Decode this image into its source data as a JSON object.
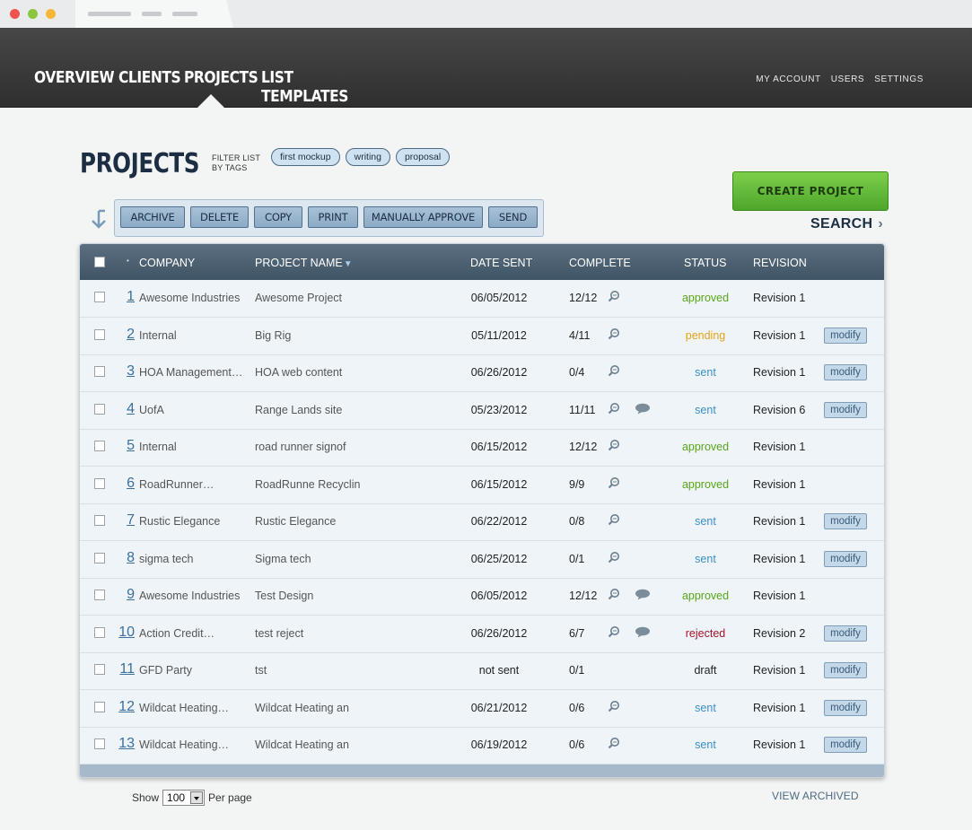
{
  "nav": {
    "main": [
      "OVERVIEW",
      "CLIENTS",
      "PROJECTS",
      "LIST TEMPLATES"
    ],
    "right": [
      "MY ACCOUNT",
      "USERS",
      "SETTINGS"
    ]
  },
  "page": {
    "title": "PROJECTS",
    "filter_label": "FILTER LIST BY TAGS",
    "tags": [
      "first mockup",
      "writing",
      "proposal"
    ],
    "create_button": "CREATE PROJECT",
    "search_label": "SEARCH",
    "search_chevron": "›"
  },
  "actions": [
    "ARCHIVE",
    "DELETE",
    "COPY",
    "PRINT",
    "MANUALLY APPROVE",
    "SEND"
  ],
  "table": {
    "headers": {
      "sort_marker": "•",
      "company": "COMPANY",
      "project": "PROJECT NAME",
      "date": "DATE SENT",
      "complete": "COMPLETE",
      "status": "STATUS",
      "revision": "REVISION"
    },
    "rows": [
      {
        "num": "1",
        "company": "Awesome Industries",
        "project": "Awesome Project",
        "date": "06/05/2012",
        "complete": "12/12",
        "zoom": true,
        "comment": false,
        "status": "approved",
        "revision": "Revision 1",
        "modify": ""
      },
      {
        "num": "2",
        "company": "Internal",
        "project": "Big Rig",
        "date": "05/11/2012",
        "complete": "4/11",
        "zoom": true,
        "comment": false,
        "status": "pending",
        "revision": "Revision 1",
        "modify": "modify"
      },
      {
        "num": "3",
        "company": "HOA Management…",
        "project": "HOA web content",
        "date": "06/26/2012",
        "complete": "0/4",
        "zoom": true,
        "comment": false,
        "status": "sent",
        "revision": "Revision 1",
        "modify": "modify"
      },
      {
        "num": "4",
        "company": "UofA",
        "project": "Range Lands site",
        "date": "05/23/2012",
        "complete": "11/11",
        "zoom": true,
        "comment": true,
        "status": "sent",
        "revision": "Revision 6",
        "modify": "modify"
      },
      {
        "num": "5",
        "company": "Internal",
        "project": "road runner signof",
        "date": "06/15/2012",
        "complete": "12/12",
        "zoom": true,
        "comment": false,
        "status": "approved",
        "revision": "Revision 1",
        "modify": ""
      },
      {
        "num": "6",
        "company": "RoadRunner…",
        "project": "RoadRunne Recyclin",
        "date": "06/15/2012",
        "complete": "9/9",
        "zoom": true,
        "comment": false,
        "status": "approved",
        "revision": "Revision 1",
        "modify": ""
      },
      {
        "num": "7",
        "company": "Rustic Elegance",
        "project": "Rustic Elegance",
        "date": "06/22/2012",
        "complete": "0/8",
        "zoom": true,
        "comment": false,
        "status": "sent",
        "revision": "Revision 1",
        "modify": "modify"
      },
      {
        "num": "8",
        "company": "sigma tech",
        "project": "Sigma tech",
        "date": "06/25/2012",
        "complete": "0/1",
        "zoom": true,
        "comment": false,
        "status": "sent",
        "revision": "Revision 1",
        "modify": "modify"
      },
      {
        "num": "9",
        "company": "Awesome Industries",
        "project": "Test Design",
        "date": "06/05/2012",
        "complete": "12/12",
        "zoom": true,
        "comment": true,
        "status": "approved",
        "revision": "Revision 1",
        "modify": ""
      },
      {
        "num": "10",
        "company": "Action Credit…",
        "project": "test reject",
        "date": "06/26/2012",
        "complete": "6/7",
        "zoom": true,
        "comment": true,
        "status": "rejected",
        "revision": "Revision 2",
        "modify": "modify"
      },
      {
        "num": "11",
        "company": "GFD Party",
        "project": "tst",
        "date": "not sent",
        "complete": "0/1",
        "zoom": false,
        "comment": false,
        "status": "draft",
        "revision": "Revision 1",
        "modify": "modify"
      },
      {
        "num": "12",
        "company": "Wildcat Heating…",
        "project": "Wildcat Heating an",
        "date": "06/21/2012",
        "complete": "0/6",
        "zoom": true,
        "comment": false,
        "status": "sent",
        "revision": "Revision 1",
        "modify": "modify"
      },
      {
        "num": "13",
        "company": "Wildcat Heating…",
        "project": "Wildcat Heating an",
        "date": "06/19/2012",
        "complete": "0/6",
        "zoom": true,
        "comment": false,
        "status": "sent",
        "revision": "Revision 1",
        "modify": "modify"
      }
    ]
  },
  "status_colors": {
    "approved": "#5aa61a",
    "pending": "#e3a514",
    "sent": "#3a8fc8",
    "rejected": "#a8142a",
    "draft": "#222222"
  },
  "footer": {
    "show_label": "Show",
    "per_page_value": "100",
    "per_page_label": "Per page",
    "view_archived": "VIEW ARCHIVED"
  }
}
